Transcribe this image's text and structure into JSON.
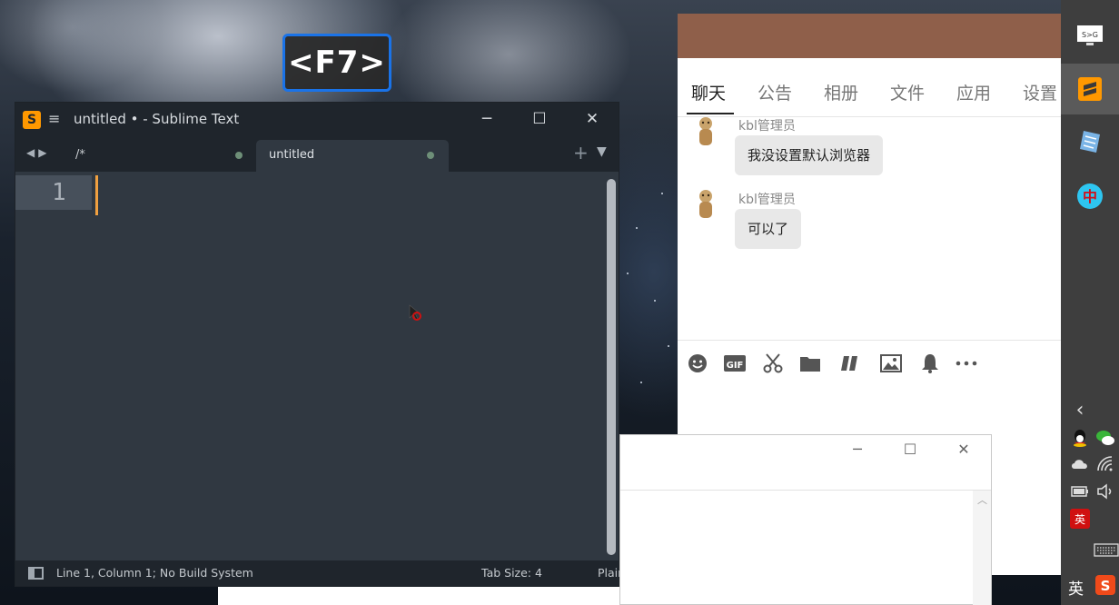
{
  "key_overlay": {
    "label": "<F7>"
  },
  "sublime": {
    "title": "untitled • - Sublime Text",
    "logo": "S",
    "tabs": [
      {
        "label": "/*"
      },
      {
        "label": "untitled"
      }
    ],
    "line_number": "1",
    "status": {
      "position": "Line 1, Column 1; No Build System",
      "tab_size": "Tab Size: 4",
      "syntax": "Plain Text"
    },
    "window_controls": {
      "minimize": "─",
      "maximize": "☐",
      "close": "✕"
    }
  },
  "chat": {
    "tabs": [
      "聊天",
      "公告",
      "相册",
      "文件",
      "应用",
      "设置"
    ],
    "messages": [
      {
        "sender": "kbl管理员",
        "text": "我没设置默认浏览器"
      },
      {
        "sender": "kbl管理员",
        "text": "可以了"
      }
    ],
    "toolbar_icons": [
      "emoji-icon",
      "gif-icon",
      "scissors-icon",
      "folder-icon",
      "music-icon",
      "image-icon",
      "bell-icon",
      "more-icon"
    ]
  },
  "dialog": {
    "controls": {
      "minimize": "─",
      "maximize": "☐",
      "close": "✕"
    }
  },
  "taskbar": {
    "sg_label": "S>G",
    "ime_label": "中",
    "lang": "英",
    "app_badge": "英"
  },
  "colors": {
    "sublime_bg": "#303841",
    "sublime_chrome": "#1f252c",
    "chat_header": "#8f5f4a",
    "key_border": "#1a73e8",
    "sublime_accent": "#ff9800"
  }
}
